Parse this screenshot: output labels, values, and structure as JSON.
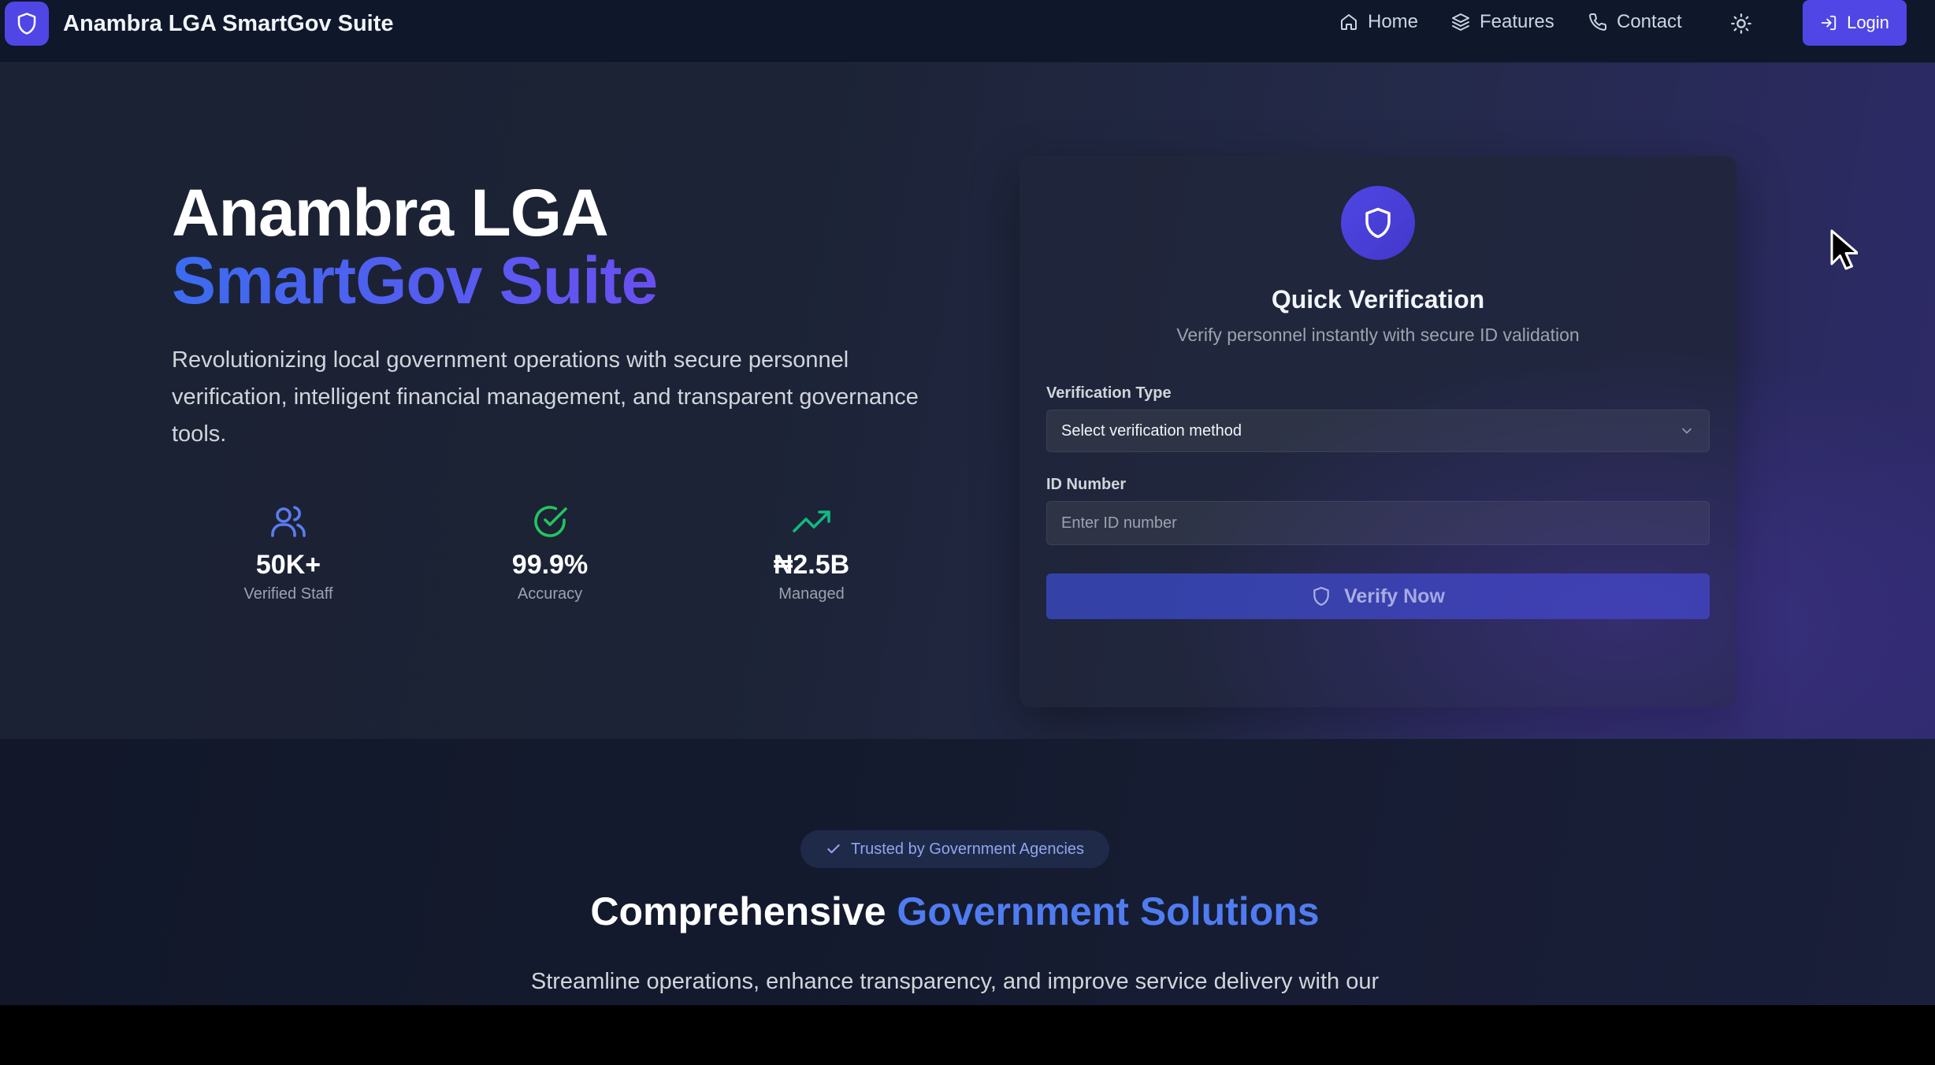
{
  "navbar": {
    "brand": "Anambra LGA SmartGov Suite",
    "links": [
      {
        "label": "Home",
        "icon": "home-icon"
      },
      {
        "label": "Features",
        "icon": "layers-icon"
      },
      {
        "label": "Contact",
        "icon": "phone-icon"
      }
    ],
    "theme_icon": "sun-icon",
    "login_label": "Login"
  },
  "hero": {
    "title_line1": "Anambra LGA",
    "title_line2": "SmartGov Suite",
    "description": "Revolutionizing local government operations with secure personnel verification, intelligent financial management, and transparent governance tools.",
    "stats": [
      {
        "value": "50K+",
        "label": "Verified Staff",
        "icon": "users-icon"
      },
      {
        "value": "99.9%",
        "label": "Accuracy",
        "icon": "check-circle-icon"
      },
      {
        "value": "₦2.5B",
        "label": "Managed",
        "icon": "trending-up-icon"
      }
    ]
  },
  "verification": {
    "title": "Quick Verification",
    "subtitle": "Verify personnel instantly with secure ID validation",
    "type_label": "Verification Type",
    "type_value": "Select verification method",
    "id_label": "ID Number",
    "id_placeholder": "Enter ID number",
    "button_label": "Verify Now"
  },
  "section2": {
    "badge": "Trusted by Government Agencies",
    "title_plain": "Comprehensive",
    "title_accent": "Government Solutions",
    "description": "Streamline operations, enhance transparency, and improve service delivery with our"
  },
  "colors": {
    "accent": "#4f46e5",
    "nav_bg": "#0f172a",
    "stat_users": "#5b7cf0",
    "stat_check": "#22c55e",
    "stat_trend": "#10b981"
  }
}
